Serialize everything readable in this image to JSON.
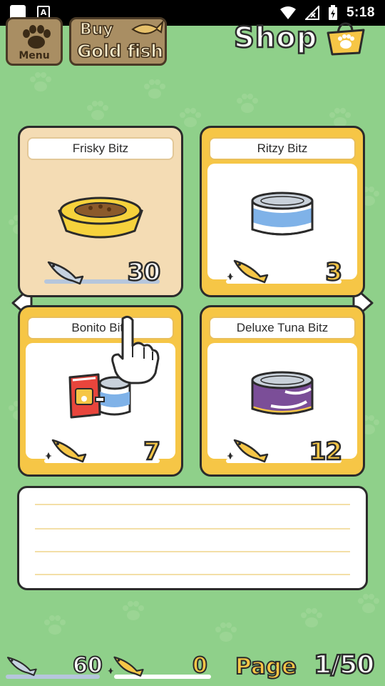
{
  "status_bar": {
    "time": "5:18",
    "notif_letter": "A"
  },
  "header": {
    "menu_label": "Menu",
    "buy_line1": "Buy",
    "buy_line2": "Gold fish",
    "title": "Shop"
  },
  "items": [
    {
      "name": "Frisky Bitz",
      "price": "30",
      "currency": "silver-fish",
      "art": "food-bowl-icon",
      "selected": true
    },
    {
      "name": "Ritzy Bitz",
      "price": "3",
      "currency": "gold-fish",
      "art": "blue-can-icon",
      "selected": false
    },
    {
      "name": "Bonito Bitz",
      "price": "7",
      "currency": "gold-fish",
      "art": "bonito-can-icon",
      "selected": false
    },
    {
      "name": "Deluxe Tuna Bitz",
      "price": "12",
      "currency": "gold-fish",
      "art": "purple-can-icon",
      "selected": false
    }
  ],
  "footer": {
    "silver_fish": "60",
    "gold_fish": "0",
    "page_label": "Page",
    "page": "1/50"
  },
  "colors": {
    "background": "#8fd08a",
    "card_gold": "#f6c646",
    "card_selected": "#f4dcb4",
    "outline": "#2b2b2b"
  }
}
